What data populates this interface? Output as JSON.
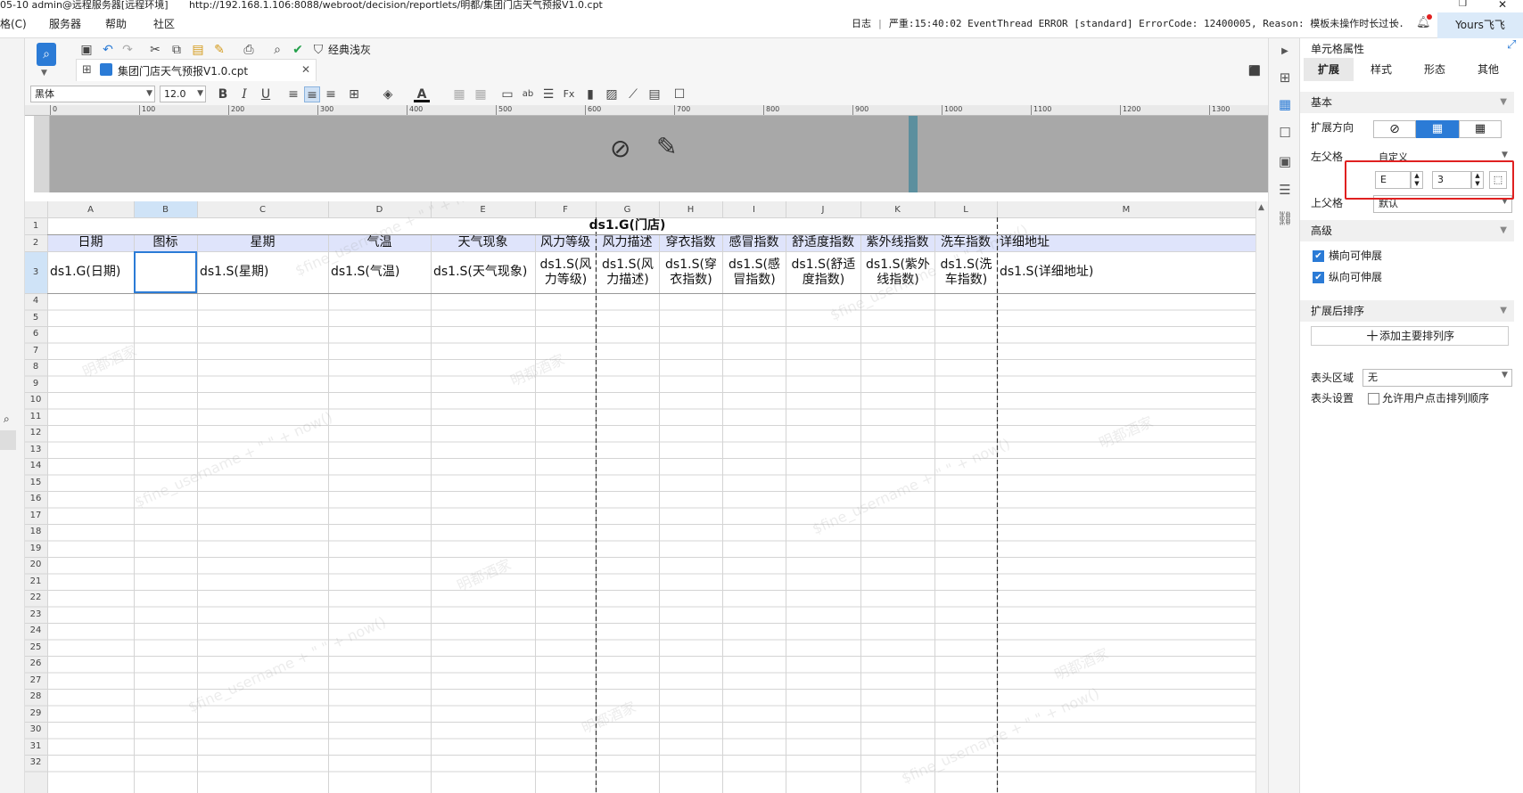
{
  "titlebar": {
    "text": "05-10 admin@远程服务器[远程环境]",
    "url": "http://192.168.1.106:8088/webroot/decision/reportlets/明都/集团门店天气预报V1.0.cpt"
  },
  "menu": {
    "items": [
      "格(C)",
      "服务器",
      "帮助",
      "社区"
    ]
  },
  "log": {
    "label": "日志",
    "message": "严重:15:40:02 EventThread ERROR [standard] ErrorCode: 12400005, Reason: 模板未操作时长过长..."
  },
  "user": {
    "name": "Yours飞飞"
  },
  "toolbar": {
    "classic_label": "经典浅灰"
  },
  "tab": {
    "filename": "集团门店天气预报V1.0.cpt"
  },
  "format": {
    "font_name": "黑体",
    "font_size": "12.0"
  },
  "ruler": {
    "ticks": [
      "0",
      "100",
      "200",
      "300",
      "400",
      "500",
      "600",
      "700",
      "800",
      "900",
      "1000",
      "1100",
      "1200",
      "1300"
    ]
  },
  "grid": {
    "col_headers": [
      "A",
      "B",
      "C",
      "D",
      "E",
      "F",
      "G",
      "H",
      "I",
      "J",
      "K",
      "L",
      "M"
    ],
    "row_numbers": [
      "1",
      "2",
      "3",
      "4",
      "5",
      "6",
      "7",
      "8",
      "9",
      "10",
      "11",
      "12",
      "13",
      "14",
      "15",
      "16",
      "17",
      "18",
      "19",
      "20",
      "21",
      "22",
      "23",
      "24",
      "25",
      "26",
      "27",
      "28",
      "29",
      "30",
      "31",
      "32"
    ],
    "title_cell": "ds1.G(门店)",
    "headers": [
      "日期",
      "图标",
      "星期",
      "气温",
      "天气现象",
      "风力等级",
      "风力描述",
      "穿衣指数",
      "感冒指数",
      "舒适度指数",
      "紫外线指数",
      "洗车指数",
      "详细地址"
    ],
    "data": [
      "ds1.G(日期)",
      "",
      "ds1.S(星期)",
      "ds1.S(气温)",
      "ds1.S(天气现象)",
      "ds1.S(风力等级)",
      "ds1.S(风力描述)",
      "ds1.S(穿衣指数)",
      "ds1.S(感冒指数)",
      "ds1.S(舒适度指数)",
      "ds1.S(紫外线指数)",
      "ds1.S(洗车指数)",
      "ds1.S(详细地址)"
    ],
    "watermark": "$fine_username + \" \" + now()",
    "watermark2": "明都酒家"
  },
  "panel": {
    "title": "单元格属性",
    "tabs": [
      "扩展",
      "样式",
      "形态",
      "其他"
    ],
    "basic_section": "基本",
    "expand_dir_label": "扩展方向",
    "left_parent_label": "左父格",
    "left_parent_value": "自定义",
    "left_parent_col": "E",
    "left_parent_row": "3",
    "top_parent_label": "上父格",
    "top_parent_value": "默认",
    "advanced_section": "高级",
    "h_expand_label": "横向可伸展",
    "v_expand_label": "纵向可伸展",
    "sort_section": "扩展后排序",
    "add_sort_label": "添加主要排列序",
    "header_area_label": "表头区域",
    "header_area_value": "无",
    "header_setting_label": "表头设置",
    "allow_sort_label": "允许用户点击排列顺序"
  },
  "colors": {
    "accent": "#2b7bd6",
    "header_row": "#dfe4fb",
    "highlight": "#e02020"
  }
}
